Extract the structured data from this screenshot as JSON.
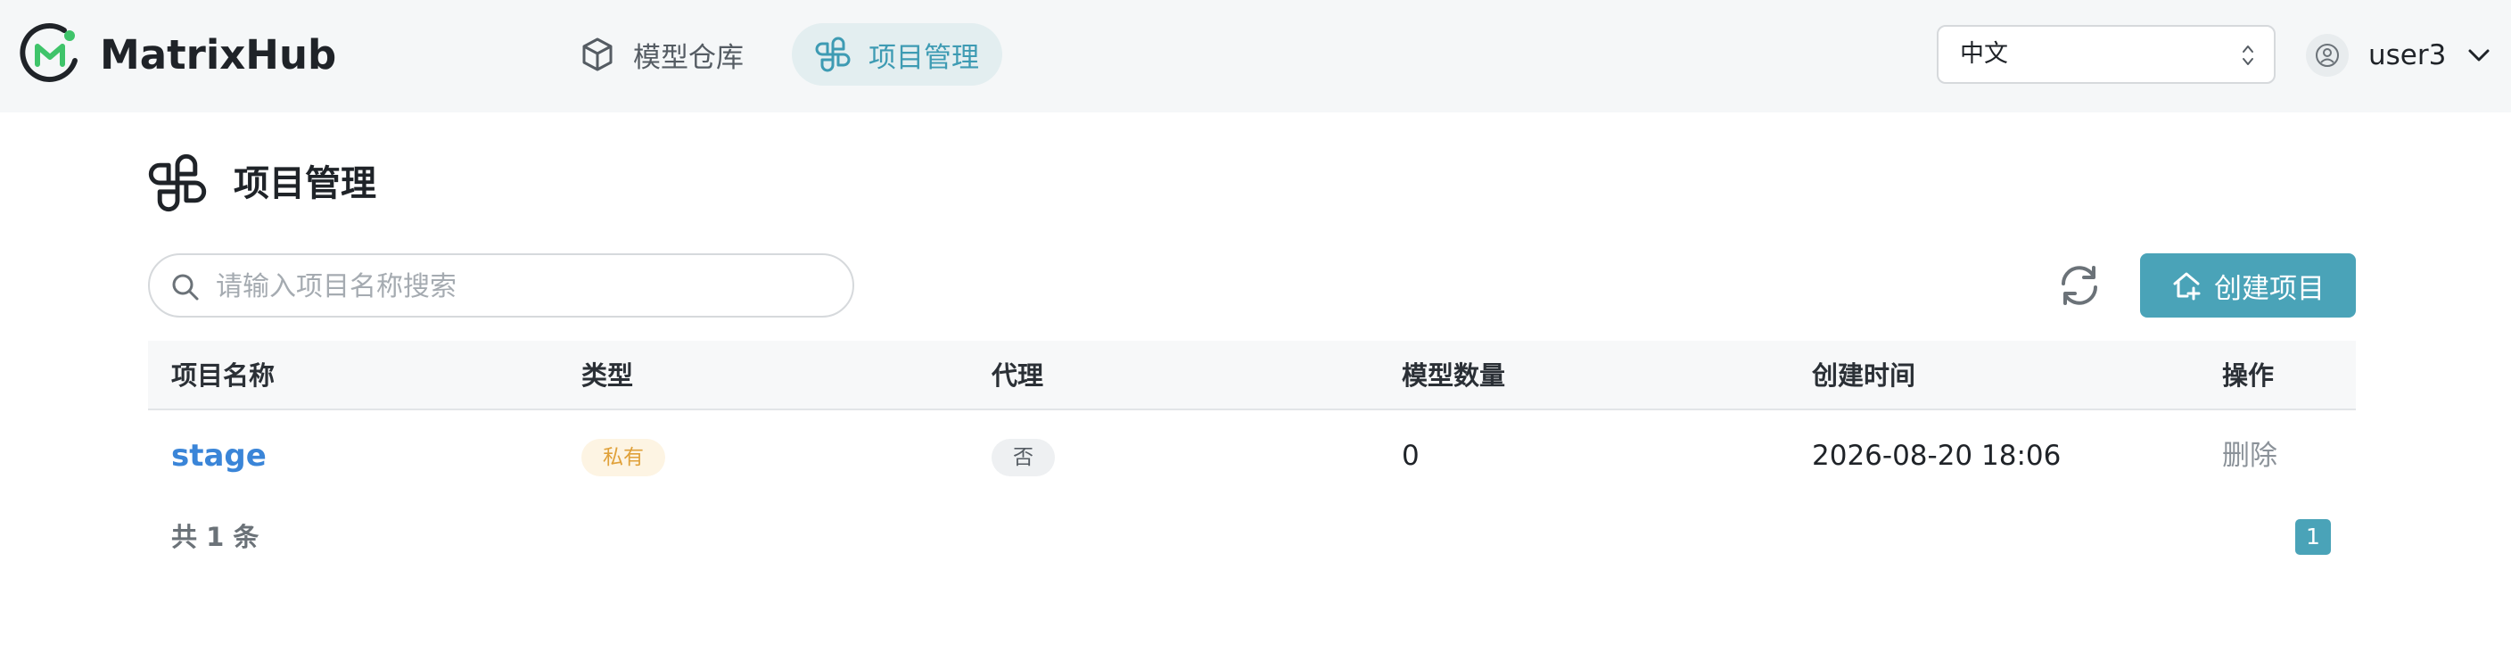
{
  "app": {
    "brand": "MatrixHub"
  },
  "nav": {
    "models_label": "模型仓库",
    "projects_label": "项目管理"
  },
  "language": {
    "selected": "中文"
  },
  "user": {
    "name": "user3"
  },
  "page": {
    "title": "项目管理"
  },
  "search": {
    "placeholder": "请输入项目名称搜索",
    "value": ""
  },
  "toolbar": {
    "create_label": "创建项目"
  },
  "table": {
    "headers": [
      "项目名称",
      "类型",
      "代理",
      "模型数量",
      "创建时间",
      "操作"
    ],
    "rows": [
      {
        "name": "stage",
        "type": "私有",
        "proxy": "否",
        "model_count": "0",
        "created": "2026-08-20 18:06",
        "action": "删除"
      }
    ]
  },
  "pagination": {
    "total_text": "共 1 条",
    "current_page": "1"
  },
  "colors": {
    "accent": "#4aa3b8",
    "link": "#3a85d8",
    "logo_green": "#3fc46a"
  },
  "icons": {
    "logo": "matrixhub-logo",
    "models": "cube-icon",
    "projects": "pinwheel-icon",
    "search": "search-icon",
    "refresh": "refresh-icon",
    "create": "home-plus-icon",
    "avatar": "user-circle-icon",
    "dropdown": "chevron-down-icon"
  }
}
